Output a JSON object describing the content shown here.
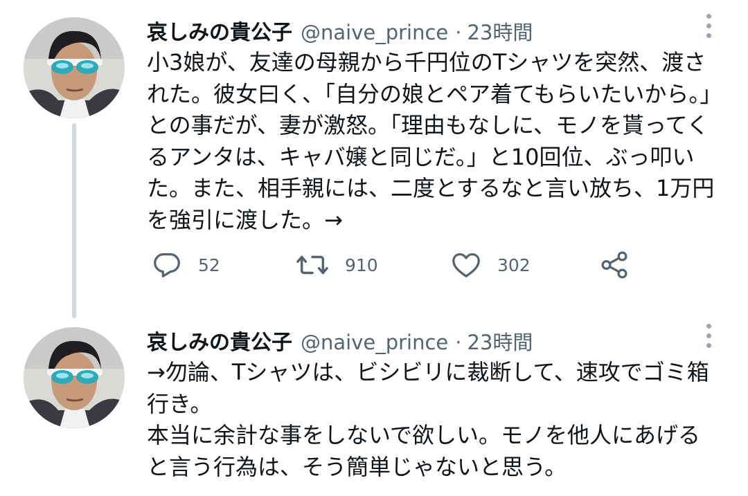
{
  "tweets": [
    {
      "author_name": "哀しみの貴公子",
      "handle": "@naive_prince",
      "separator": "·",
      "time": "23時間",
      "text": "小3娘が、友達の母親から千円位のTシャツを突然、渡された。彼女曰く、「自分の娘とペア着てもらいたいから。」との事だが、妻が激怒。「理由もなしに、モノを貰ってくるアンタは、キャバ嬢と同じだ。」と10回位、ぶっ叩いた。また、相手親には、二度とするなと言い放ち、1万円を強引に渡した。→",
      "reply_count": "52",
      "retweet_count": "910",
      "like_count": "302"
    },
    {
      "author_name": "哀しみの貴公子",
      "handle": "@naive_prince",
      "separator": "·",
      "time": "23時間",
      "text": "→勿論、Tシャツは、ビシビリに裁断して、速攻でゴミ箱行き。\n本当に余計な事をしないで欲しい。モノを他人にあげると言う行為は、そう簡単じゃないと思う。"
    }
  ],
  "icons": {
    "reply": "reply-icon",
    "retweet": "retweet-icon",
    "like": "like-icon",
    "share": "share-icon",
    "more": "more-icon"
  },
  "colors": {
    "text": "#0f1419",
    "secondary": "#536471",
    "thread_line": "#cfd9de"
  }
}
